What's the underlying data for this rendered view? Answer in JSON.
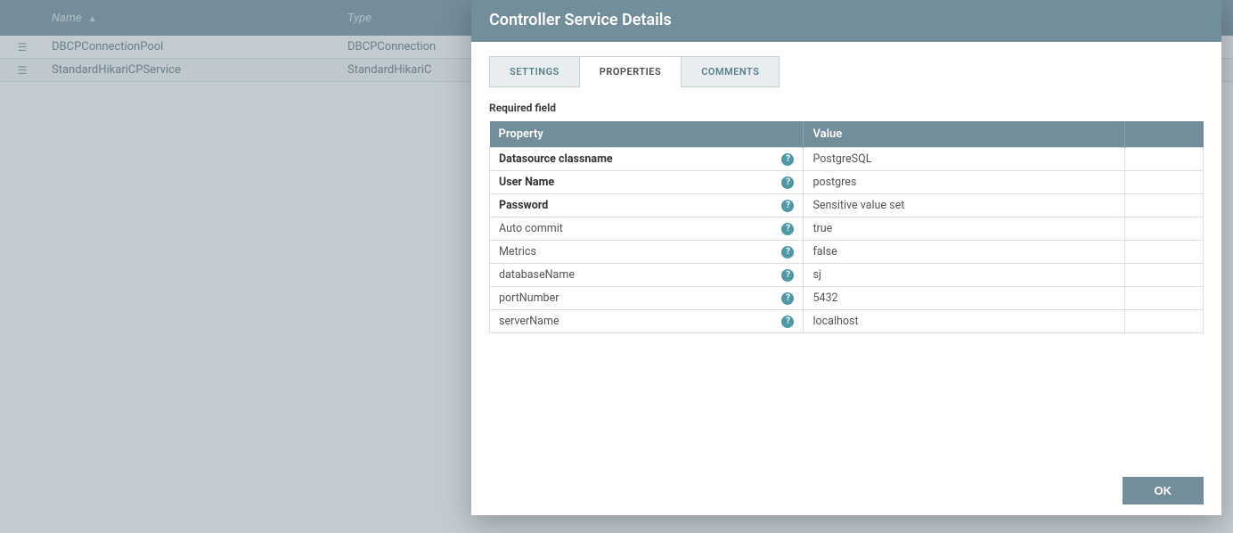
{
  "bg_header": {
    "name": "Name",
    "type": "Type"
  },
  "bg_rows": [
    {
      "name": "DBCPConnectionPool",
      "type": "DBCPConnection"
    },
    {
      "name": "StandardHikariCPService",
      "type": "StandardHikariC"
    }
  ],
  "dialog": {
    "title": "Controller Service Details",
    "tabs": {
      "settings": "SETTINGS",
      "properties": "PROPERTIES",
      "comments": "COMMENTS"
    },
    "required_label": "Required field",
    "table_header": {
      "property": "Property",
      "value": "Value"
    },
    "properties": [
      {
        "name": "Datasource classname",
        "value": "PostgreSQL",
        "required": true,
        "sensitive": false
      },
      {
        "name": "User Name",
        "value": "postgres",
        "required": true,
        "sensitive": false
      },
      {
        "name": "Password",
        "value": "Sensitive value set",
        "required": true,
        "sensitive": true
      },
      {
        "name": "Auto commit",
        "value": "true",
        "required": false,
        "sensitive": false
      },
      {
        "name": "Metrics",
        "value": "false",
        "required": false,
        "sensitive": false
      },
      {
        "name": "databaseName",
        "value": "sj",
        "required": false,
        "sensitive": false
      },
      {
        "name": "portNumber",
        "value": "5432",
        "required": false,
        "sensitive": false
      },
      {
        "name": "serverName",
        "value": "localhost",
        "required": false,
        "sensitive": false
      }
    ],
    "ok_label": "OK"
  }
}
